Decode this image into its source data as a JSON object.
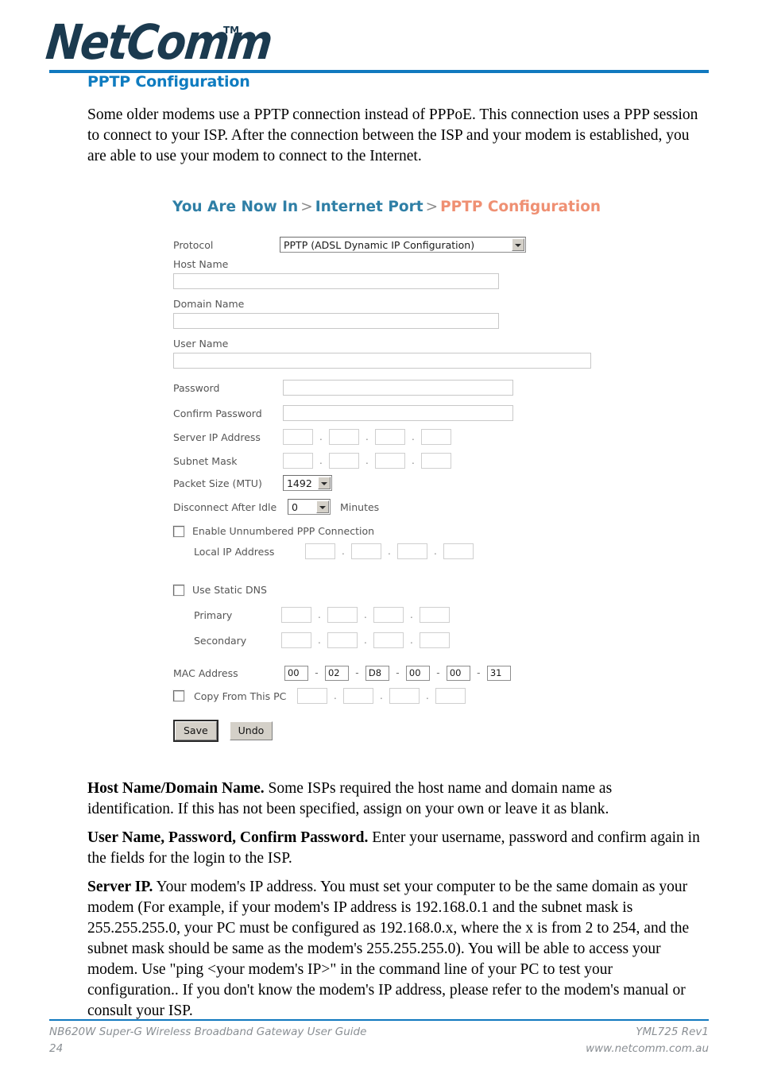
{
  "brand": {
    "logo_text": "NetComm",
    "logo_tm": "TM"
  },
  "page": {
    "heading": "PPTP Configuration",
    "intro": "Some older modems use a PPTP connection instead of PPPoE.  This connection uses a PPP session to connect to your ISP.  After the connection between the ISP and your modem is established, you are able to use your modem to connect to the Internet."
  },
  "screenshot": {
    "breadcrumb": {
      "part1": "You Are Now In",
      "sep1": ">",
      "part2": "Internet Port",
      "sep2": ">",
      "part3": "PPTP Configuration"
    },
    "labels": {
      "protocol": "Protocol",
      "host_name": "Host Name",
      "domain_name": "Domain Name",
      "user_name": "User Name",
      "password": "Password",
      "confirm_password": "Confirm Password",
      "server_ip": "Server IP Address",
      "subnet_mask": "Subnet Mask",
      "packet_size": "Packet Size (MTU)",
      "disconnect_idle": "Disconnect After Idle",
      "minutes": "Minutes",
      "enable_unnumbered": "Enable Unnumbered PPP Connection",
      "local_ip": "Local IP Address",
      "use_static_dns": "Use Static DNS",
      "primary": "Primary",
      "secondary": "Secondary",
      "mac_address": "MAC Address",
      "copy_from_pc": "Copy From This PC"
    },
    "values": {
      "protocol": "PPTP (ADSL Dynamic IP Configuration)",
      "host_name": "",
      "domain_name": "",
      "user_name": "",
      "password": "",
      "confirm_password": "",
      "packet_size": "1492",
      "disconnect_idle": "0",
      "server_ip_octets": [
        "",
        "",
        "",
        ""
      ],
      "subnet_mask_octets": [
        "",
        "",
        "",
        ""
      ],
      "local_ip_octets": [
        "",
        "",
        "",
        ""
      ],
      "dns_primary_octets": [
        "",
        "",
        "",
        ""
      ],
      "dns_secondary_octets": [
        "",
        "",
        "",
        ""
      ],
      "mac_octets": [
        "00",
        "02",
        "D8",
        "00",
        "00",
        "31"
      ],
      "copy_pc_octets": [
        "",
        "",
        "",
        ""
      ],
      "enable_unnumbered_checked": false,
      "use_static_dns_checked": false,
      "copy_from_pc_checked": false
    },
    "separators": {
      "dot": ".",
      "dash": "-"
    },
    "buttons": {
      "save": "Save",
      "undo": "Undo"
    },
    "colors": {
      "breadcrumb_blue": "#2f7fa6",
      "breadcrumb_orange": "#ef9073"
    }
  },
  "notes": [
    {
      "lead": "Host Name/Domain Name.",
      "text": " Some ISPs required the host name and domain name as identification.  If this has not been specified, assign on your own or leave it as blank."
    },
    {
      "lead": "User Name, Password, Confirm Password.",
      "text": " Enter your username, password and confirm again in the fields for the login to the ISP."
    },
    {
      "lead": "Server IP.",
      "text": " Your modem's IP address.  You must set your computer to be the same domain as your modem (For example, if your modem's IP address is 192.168.0.1 and the subnet mask is 255.255.255.0, your PC must be configured as 192.168.0.x, where the x is from 2 to 254, and the subnet mask should be same as the modem's 255.255.255.0).  You will be able to access your modem. Use \"ping <your modem's IP>\" in the command line of your PC to test your configuration.. If you don't know the modem's IP address, please refer to the modem's manual or consult your ISP."
    }
  ],
  "footer": {
    "left_line1": "NB620W Super-G Wireless Broadband  Gateway User Guide",
    "left_line2": "24",
    "right_line1": "YML725 Rev1",
    "right_line2": "www.netcomm.com.au"
  },
  "theme": {
    "rule_blue": "#1179bf",
    "heading_blue": "#0f7cc0",
    "logo_navy": "#1b3a4f",
    "footer_gray": "#8a8f94"
  }
}
